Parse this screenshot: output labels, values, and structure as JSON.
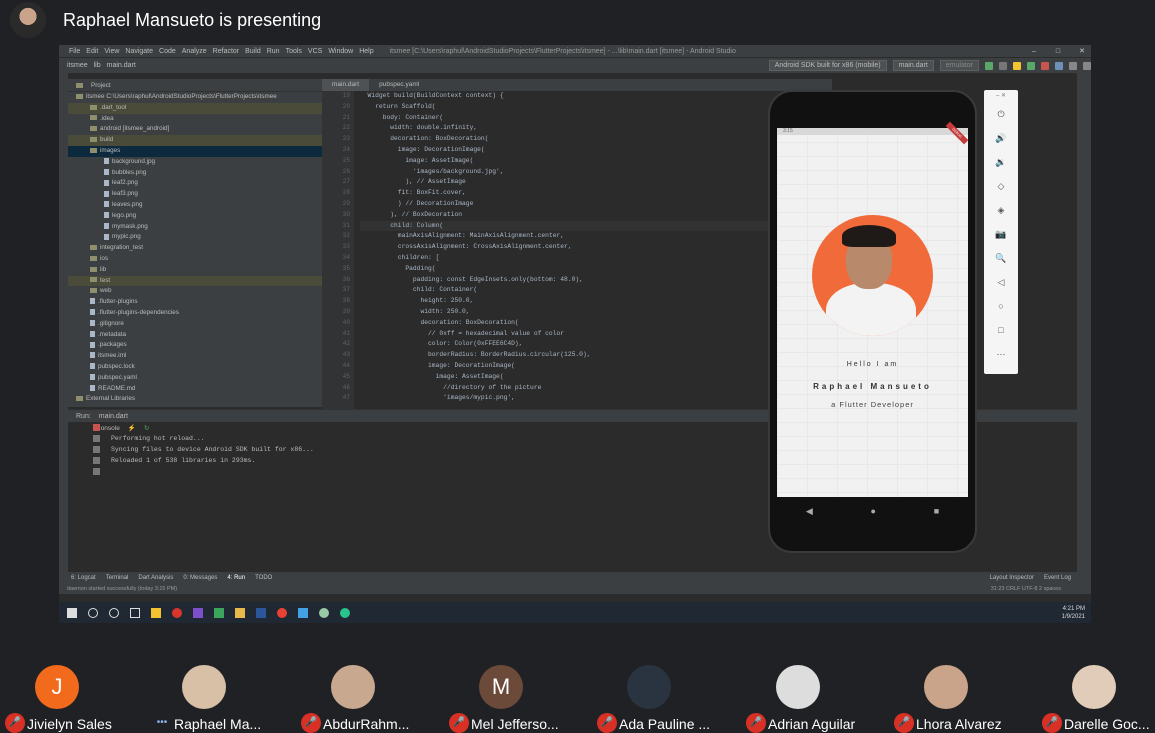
{
  "meet": {
    "presenter_title": "Raphael Mansueto is presenting",
    "participants": [
      {
        "initial": "J",
        "name": "Jivielyn Sales",
        "color": "#f26a1b",
        "mic": "muted"
      },
      {
        "initial": "",
        "name": "Raphael Ma...",
        "color": "#d7c0a6",
        "mic": "speaking"
      },
      {
        "initial": "",
        "name": "AbdurRahm...",
        "color": "#c8a88f",
        "mic": "muted"
      },
      {
        "initial": "M",
        "name": "Mel Jefferso...",
        "color": "#6b4a3a",
        "mic": "muted"
      },
      {
        "initial": "",
        "name": "Ada Pauline ...",
        "color": "#2a3340",
        "mic": "muted"
      },
      {
        "initial": "",
        "name": "Adrian Aguilar",
        "color": "#dddddd",
        "mic": "muted"
      },
      {
        "initial": "",
        "name": "Lhora Alvarez",
        "color": "#c9a38a",
        "mic": "muted"
      },
      {
        "initial": "",
        "name": "Darelle Goc...",
        "color": "#e0ccb8",
        "mic": "muted"
      }
    ]
  },
  "ide": {
    "menu": [
      "File",
      "Edit",
      "View",
      "Navigate",
      "Code",
      "Analyze",
      "Refactor",
      "Build",
      "Run",
      "Tools",
      "VCS",
      "Window",
      "Help"
    ],
    "window_title": "itsmee [C:\\Users\\raphul\\AndroidStudioProjects\\FlutterProjects\\itsmee] - ...\\lib\\main.dart [itsmee] - Android Studio",
    "breadcrumb": [
      "itsmee",
      "lib",
      "main.dart"
    ],
    "device": "Android SDK built for x86 (mobile)",
    "run_config": "main.dart",
    "emulator": "emulator",
    "project_label": "Project",
    "tree": [
      {
        "indent": 0,
        "type": "folder",
        "label": "itsmee  C:\\Users\\raphul\\AndroidStudioProjects\\FlutterProjects\\itsmee",
        "state": ""
      },
      {
        "indent": 1,
        "type": "folder",
        "label": ".dart_tool",
        "state": "hl"
      },
      {
        "indent": 1,
        "type": "folder",
        "label": ".idea",
        "state": ""
      },
      {
        "indent": 1,
        "type": "folder",
        "label": "android [itsmee_android]",
        "state": ""
      },
      {
        "indent": 1,
        "type": "folder",
        "label": "build",
        "state": "hl"
      },
      {
        "indent": 1,
        "type": "folder",
        "label": "images",
        "state": "sel"
      },
      {
        "indent": 2,
        "type": "file",
        "label": "background.jpg",
        "state": ""
      },
      {
        "indent": 2,
        "type": "file",
        "label": "bubbles.png",
        "state": ""
      },
      {
        "indent": 2,
        "type": "file",
        "label": "leaf2.png",
        "state": ""
      },
      {
        "indent": 2,
        "type": "file",
        "label": "leaf3.png",
        "state": ""
      },
      {
        "indent": 2,
        "type": "file",
        "label": "leaves.png",
        "state": ""
      },
      {
        "indent": 2,
        "type": "file",
        "label": "lego.png",
        "state": ""
      },
      {
        "indent": 2,
        "type": "file",
        "label": "mymask.png",
        "state": ""
      },
      {
        "indent": 2,
        "type": "file",
        "label": "mypic.png",
        "state": ""
      },
      {
        "indent": 1,
        "type": "folder",
        "label": "integration_test",
        "state": ""
      },
      {
        "indent": 1,
        "type": "folder",
        "label": "ios",
        "state": ""
      },
      {
        "indent": 1,
        "type": "folder",
        "label": "lib",
        "state": ""
      },
      {
        "indent": 1,
        "type": "folder",
        "label": "test",
        "state": "hl"
      },
      {
        "indent": 1,
        "type": "folder",
        "label": "web",
        "state": ""
      },
      {
        "indent": 1,
        "type": "file",
        "label": ".flutter-plugins",
        "state": ""
      },
      {
        "indent": 1,
        "type": "file",
        "label": ".flutter-plugins-dependencies",
        "state": ""
      },
      {
        "indent": 1,
        "type": "file",
        "label": ".gitignore",
        "state": ""
      },
      {
        "indent": 1,
        "type": "file",
        "label": ".metadata",
        "state": ""
      },
      {
        "indent": 1,
        "type": "file",
        "label": ".packages",
        "state": ""
      },
      {
        "indent": 1,
        "type": "file",
        "label": "itsmee.iml",
        "state": ""
      },
      {
        "indent": 1,
        "type": "file",
        "label": "pubspec.lock",
        "state": ""
      },
      {
        "indent": 1,
        "type": "file",
        "label": "pubspec.yaml",
        "state": ""
      },
      {
        "indent": 1,
        "type": "file",
        "label": "README.md",
        "state": ""
      },
      {
        "indent": 0,
        "type": "folder",
        "label": "External Libraries",
        "state": ""
      }
    ],
    "editor_tabs": [
      "main.dart",
      "pubspec.yaml"
    ],
    "code_lines": [
      {
        "n": "19",
        "t": "  Widget build(BuildContext context) {"
      },
      {
        "n": "20",
        "t": "    return Scaffold("
      },
      {
        "n": "21",
        "t": "      body: Container("
      },
      {
        "n": "22",
        "t": "        width: double.infinity,"
      },
      {
        "n": "23",
        "t": "        decoration: BoxDecoration("
      },
      {
        "n": "24",
        "t": "          image: DecorationImage("
      },
      {
        "n": "25",
        "t": "            image: AssetImage("
      },
      {
        "n": "26",
        "t": "              'images/background.jpg',"
      },
      {
        "n": "27",
        "t": "            ), // AssetImage"
      },
      {
        "n": "28",
        "t": "          fit: BoxFit.cover,"
      },
      {
        "n": "29",
        "t": "          ) // DecorationImage"
      },
      {
        "n": "30",
        "t": "        ), // BoxDecoration"
      },
      {
        "n": "31",
        "t": "        child: Column("
      },
      {
        "n": "32",
        "t": "          mainAxisAlignment: MainAxisAlignment.center,"
      },
      {
        "n": "33",
        "t": "          crossAxisAlignment: CrossAxisAlignment.center,"
      },
      {
        "n": "34",
        "t": "          children: ["
      },
      {
        "n": "35",
        "t": "            Padding("
      },
      {
        "n": "36",
        "t": "              padding: const EdgeInsets.only(bottom: 48.0),"
      },
      {
        "n": "37",
        "t": "              child: Container("
      },
      {
        "n": "38",
        "t": "                height: 250.0,"
      },
      {
        "n": "39",
        "t": "                width: 250.0,"
      },
      {
        "n": "40",
        "t": "                decoration: BoxDecoration("
      },
      {
        "n": "41",
        "t": "                  // 0xff = hexadecimal value of color"
      },
      {
        "n": "42",
        "t": "                  color: Color(0xFFEE6C4D),"
      },
      {
        "n": "43",
        "t": "                  borderRadius: BorderRadius.circular(125.0),"
      },
      {
        "n": "44",
        "t": "                  image: DecorationImage("
      },
      {
        "n": "45",
        "t": "                    image: AssetImage("
      },
      {
        "n": "46",
        "t": "                      //directory of the picture"
      },
      {
        "n": "47",
        "t": "                      'images/mypic.png',"
      }
    ],
    "run_label": "Run:",
    "run_tab": "main.dart",
    "console_label": "Console",
    "console_lines": [
      "Performing hot reload...",
      "Syncing files to device Android SDK built for x86...",
      "Reloaded 1 of 538 libraries in 293ms."
    ],
    "bottom_tabs": [
      "6: Logcat",
      "Terminal",
      "Dart Analysis",
      "0: Messages",
      "4: Run",
      "TODO"
    ],
    "bottom_right_tabs": [
      "Layout Inspector",
      "Event Log"
    ],
    "status_left": "daemon started successfully (today 3:15 PM)",
    "status_right": "31:23  CRLF  UTF-8  2 spaces",
    "clock_time": "4:21 PM",
    "clock_date": "1/9/2021"
  },
  "phone": {
    "status_time": "3:15",
    "debug_label": "DEBUG",
    "hello": "Hello I am",
    "name": "Raphael Mansueto",
    "role": "a Flutter Developer",
    "nav": [
      "◀",
      "●",
      "■"
    ]
  },
  "emulator_controls": [
    "⏻",
    "🔊",
    "🔉",
    "◇",
    "◈",
    "📷",
    "🔍",
    "◁",
    "○",
    "□",
    "⋯"
  ]
}
